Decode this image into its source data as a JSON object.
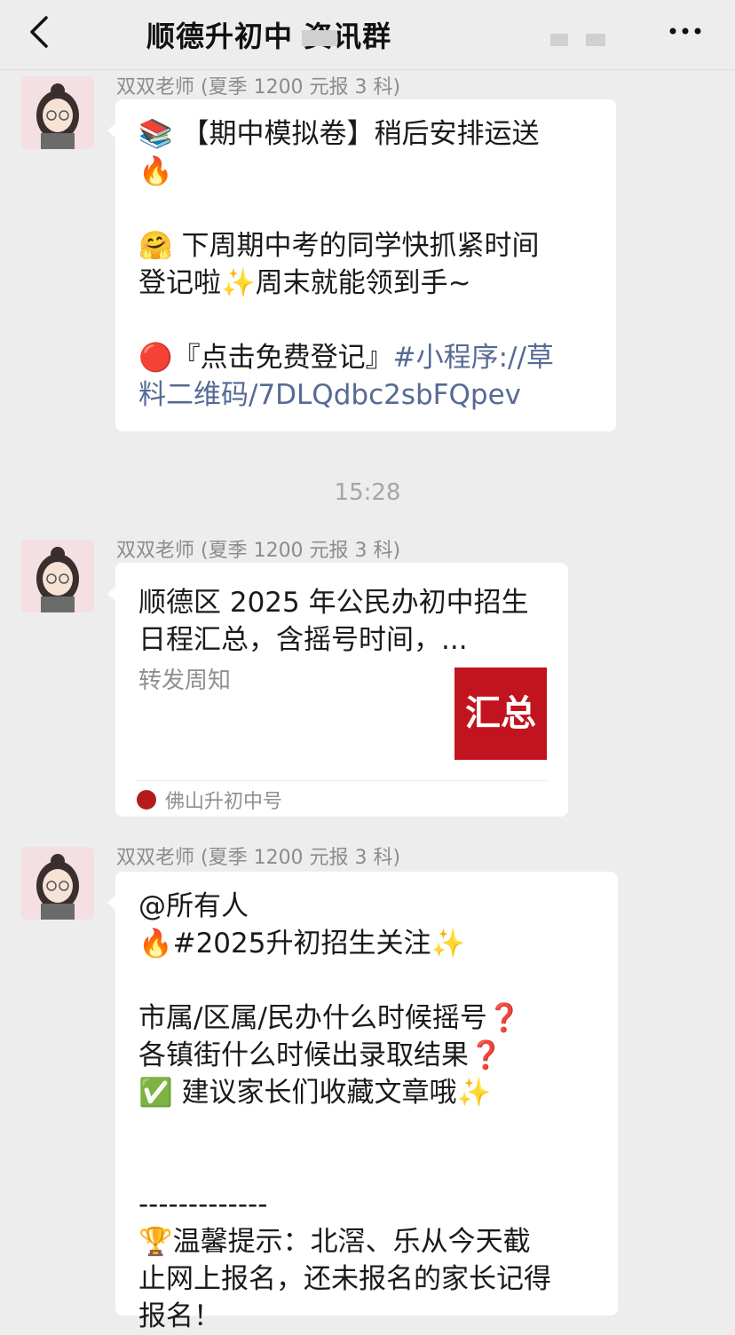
{
  "header": {
    "title": "顺德升初中          资讯群"
  },
  "messages": [
    {
      "sender": "双双老师 (夏季 1200 元报 3 科)",
      "lines": [
        "📚 【期中模拟卷】稍后安排运送",
        "🔥",
        "",
        "🤗 下周期中考的同学快抓紧时间",
        "登记啦✨周末就能领到手~",
        "",
        "🔴『点击免费登记』"
      ],
      "link_line1": "#小程序://草",
      "link_line2": "料二维码/7DLQdbc2sbFQpev",
      "prefix_line2": ""
    },
    {
      "sender": "双双老师 (夏季 1200 元报 3 科)",
      "card": {
        "title": "顺德区 2025 年公民办初中招生日程汇总，含摇号时间，...",
        "desc": "转发周知",
        "thumb_text": "汇总",
        "source": "佛山升初中号"
      }
    },
    {
      "sender": "双双老师 (夏季 1200 元报 3 科)",
      "lines": [
        "@所有人",
        "🔥#2025升初招生关注✨",
        "",
        "市属/区属/民办什么时候摇号❓",
        "各镇街什么时候出录取结果❓",
        "✅ 建议家长们收藏文章哦✨",
        "",
        "",
        "-------------",
        "🏆温馨提示：北滘、乐从今天截",
        "止网上报名，还未报名的家长记得",
        "报名！"
      ]
    }
  ],
  "timestamp": "15:28",
  "colors": {
    "background": "#ededed",
    "bubble": "#ffffff",
    "link": "#566a94",
    "sender": "#8c8c8c"
  },
  "icons": {
    "back": "chevron-left-icon",
    "more": "more-dots-icon"
  }
}
